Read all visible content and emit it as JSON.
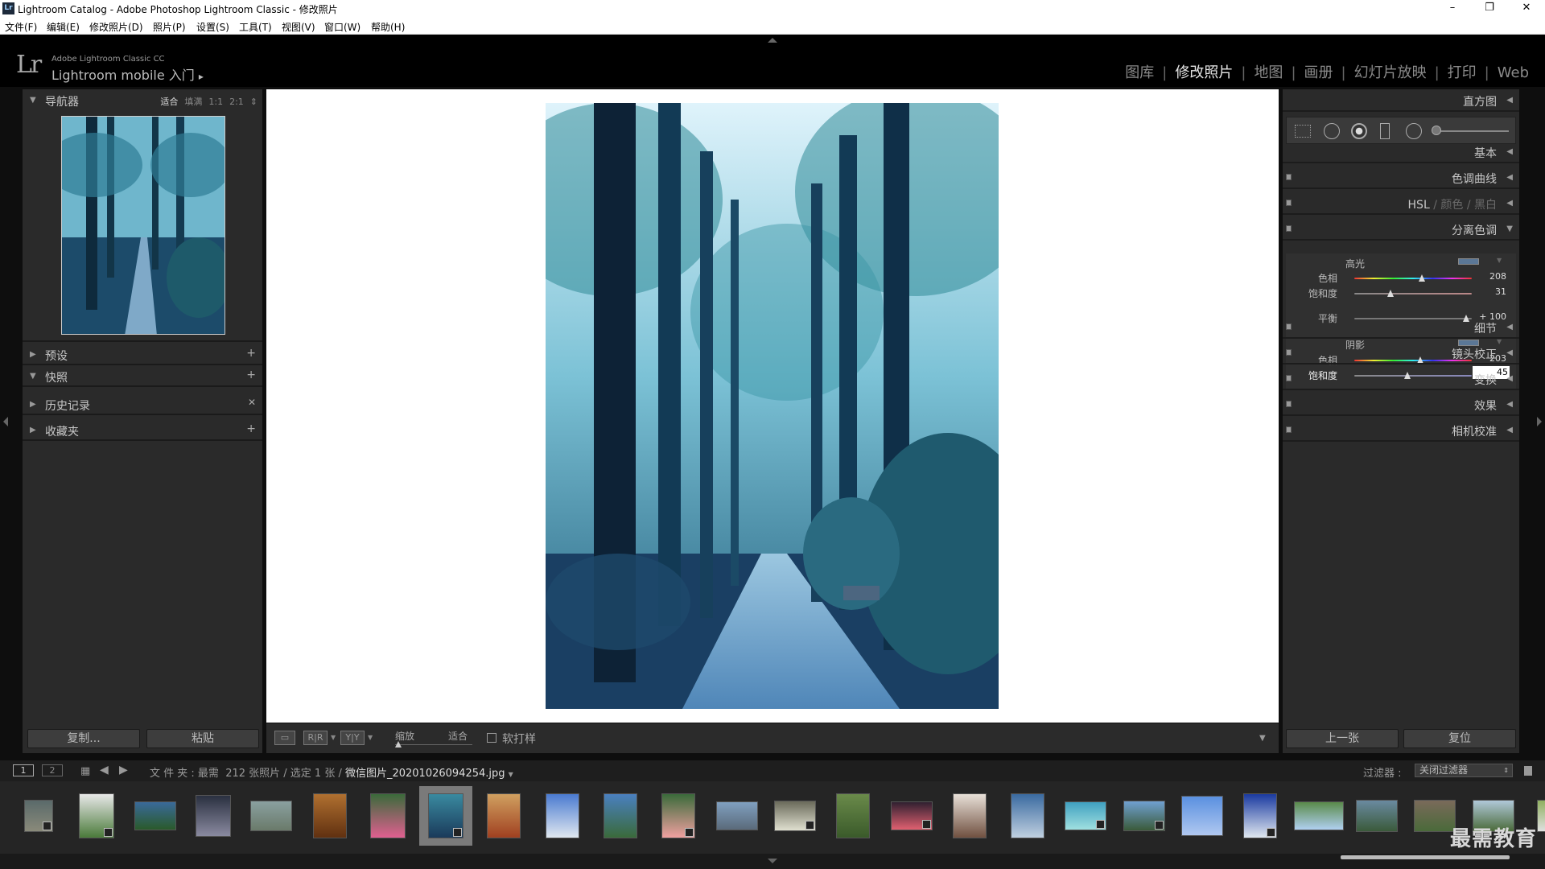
{
  "window": {
    "title": "Lightroom Catalog - Adobe Photoshop Lightroom Classic - 修改照片",
    "icon_text": "Lr",
    "controls": [
      "–",
      "❐",
      "✕"
    ]
  },
  "menu": [
    "文件(F)",
    "编辑(E)",
    "修改照片(D)",
    "照片(P)",
    "设置(S)",
    "工具(T)",
    "视图(V)",
    "窗口(W)",
    "帮助(H)"
  ],
  "identity": {
    "logo": "Lr",
    "product": "Adobe Lightroom Classic CC",
    "mobile": "Lightroom mobile 入门",
    "mobile_arrow": "▸"
  },
  "modules": {
    "items": [
      "图库",
      "修改照片",
      "地图",
      "画册",
      "幻灯片放映",
      "打印",
      "Web"
    ],
    "active": "修改照片",
    "separator": "|"
  },
  "left_panel": {
    "navigator": {
      "label": "导航器",
      "options": [
        "适合",
        "填满",
        "1:1",
        "2:1"
      ],
      "selected": "适合"
    },
    "presets": {
      "label": "预设",
      "action": "+"
    },
    "snapshots": {
      "label": "快照",
      "action": "+"
    },
    "history": {
      "label": "历史记录",
      "action": "✕"
    },
    "collections": {
      "label": "收藏夹",
      "action": "+"
    },
    "copy_button": "复制...",
    "paste_button": "粘贴"
  },
  "right_panel": {
    "histogram": "直方图",
    "basic": "基本",
    "tone_curve": "色调曲线",
    "hsl": {
      "hsl": "HSL",
      "color": "颜色",
      "bw": "黑白",
      "sep": "/"
    },
    "split_toning": {
      "label": "分离色调",
      "highlights": {
        "label": "高光",
        "hue_label": "色相",
        "hue": 208,
        "sat_label": "饱和度",
        "sat": 31
      },
      "balance": {
        "label": "平衡",
        "value": "+ 100",
        "fraction": 1.0
      },
      "shadows": {
        "label": "阴影",
        "hue_label": "色相",
        "hue": 203,
        "sat_label": "饱和度",
        "sat": "45"
      }
    },
    "detail": "细节",
    "lens": "镜头校正",
    "transform": "变换",
    "effects": "效果",
    "calibration": "相机校准",
    "prev_button": "上一张",
    "reset_button": "复位"
  },
  "toolbar": {
    "zoom_label": "缩放",
    "zoom_value": "适合",
    "softproof": "软打样",
    "ry1": "R|R",
    "ry2": "Y|Y"
  },
  "filmstrip_bar": {
    "view1": "1",
    "view2": "2",
    "path": "文 件 夹 : 最需",
    "count": "212 张照片 / 选定 1 张 /",
    "filename": "微信图片_20201026094254.jpg",
    "filter_label": "过滤器 :",
    "filter_value": "关闭过滤器"
  },
  "watermark": "最需教育",
  "colors": {
    "accent": "#e6e6e6",
    "panel": "#2a2a2a",
    "swatch": "#5b7796"
  }
}
